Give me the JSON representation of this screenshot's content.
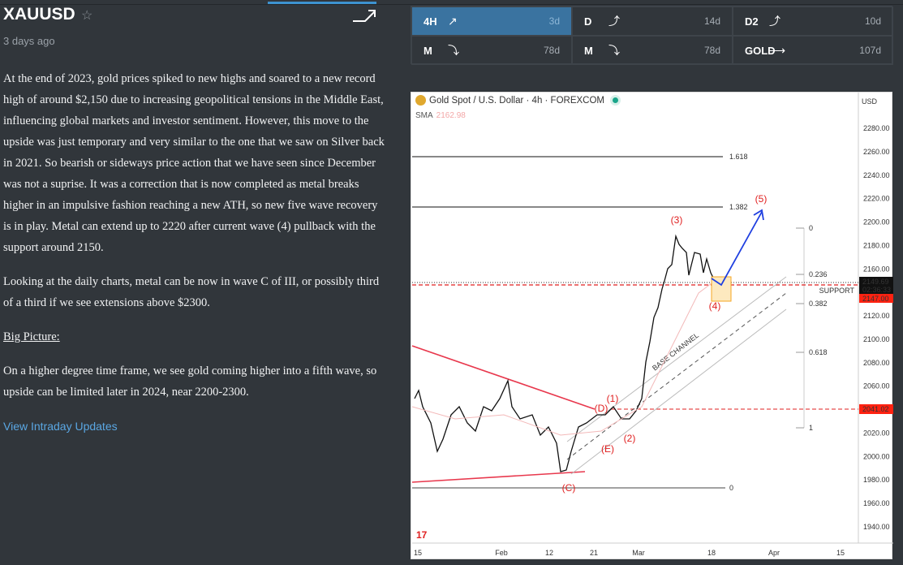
{
  "header": {
    "symbol": "XAUUSD",
    "time_ago": "3 days ago",
    "icons": [
      "star-icon",
      "trend-up-arrow-icon"
    ]
  },
  "article": {
    "paragraphs": [
      "At the end of 2023, gold prices spiked to new highs and soared to a new record high of around $2,150 due to increasing geopolitical tensions in the Middle East, influencing global markets and investor sentiment. However, this move to the upside was just temporary and very similar to the one that we saw on Silver back in 2021. So bearish or sideways price action that we have seen since December was not a suprise. It was a correction that is now completed as metal breaks higher in an impulsive fashion reaching a new ATH, so new five wave recovery is in play. Metal can extend up to 2220 after current wave (4) pullback with the support around 2150.",
      "Looking at the daily charts, metal can be now in wave C of III, or possibly third of a third if we see extensions above $2300.",
      "Big Picture:",
      "On a higher degree time frame, we see gold coming higher into a fifth wave, so upside can be limited later in 2024, near 2200-2300."
    ],
    "link": "View Intraday Updates"
  },
  "timeframes": [
    {
      "label": "4H",
      "icon": "↗",
      "age": "3d",
      "active": true
    },
    {
      "label": "D",
      "icon": "⤴",
      "age": "14d"
    },
    {
      "label": "D2",
      "icon": "⤴",
      "age": "10d"
    },
    {
      "label": "M",
      "icon": "⤵",
      "age": "78d"
    },
    {
      "label": "M",
      "icon": "⤵",
      "age": "78d"
    },
    {
      "label": "GOLD",
      "icon": "⟶",
      "age": "107d"
    }
  ],
  "chart": {
    "title": "Gold Spot / U.S. Dollar · 4h · FOREXCOM",
    "sma_label": "SMA",
    "sma_value": "2162.98",
    "currency": "USD",
    "price_ticks": [
      "2280.00",
      "2260.00",
      "2240.00",
      "2220.00",
      "2200.00",
      "2180.00",
      "2160.00",
      "2140.00",
      "2120.00",
      "2100.00",
      "2080.00",
      "2060.00",
      "2040.00",
      "2020.00",
      "2000.00",
      "1980.00",
      "1960.00",
      "1940.00"
    ],
    "time_ticks": [
      "15",
      "Feb",
      "12",
      "21",
      "Mar",
      "18",
      "Apr",
      "15"
    ],
    "last_price": "2149.69",
    "countdown": "02:36:33",
    "support_price": "2147.00",
    "support_label": "SUPPORT",
    "level_2041": "2041.02",
    "fib_ext": [
      "1.618",
      "1.382",
      "0"
    ],
    "fib_ret": [
      "0",
      "0.236",
      "0.382",
      "0.618",
      "1"
    ],
    "waves": [
      "(3)",
      "(5)",
      "(4)",
      "(D)",
      "(1)",
      "(E)",
      "(2)",
      "(C)"
    ],
    "channel_label": "BASE CHANNEL",
    "colors": {
      "wave": "#e02020",
      "projection": "#1f3fe0",
      "support": "#e02020",
      "box": "#f5a623"
    }
  }
}
